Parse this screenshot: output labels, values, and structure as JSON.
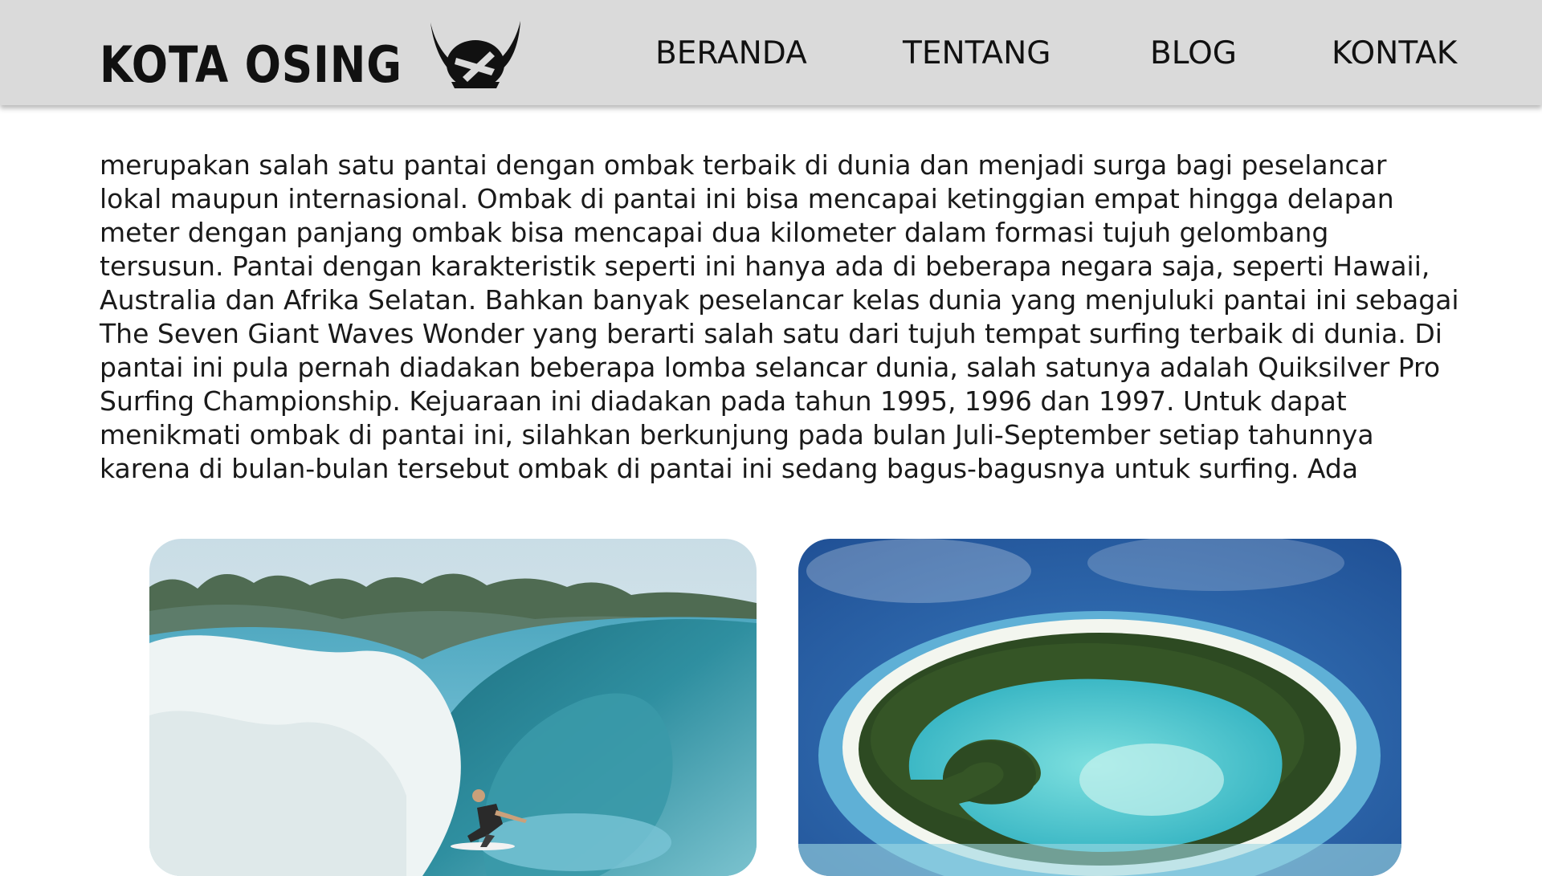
{
  "header": {
    "logo_text": "KOTA OSING",
    "logo_icon": "horned-helmet-icon",
    "nav": [
      {
        "label": "BERANDA"
      },
      {
        "label": "TENTANG"
      },
      {
        "label": "BLOG"
      },
      {
        "label": "KONTAK"
      }
    ]
  },
  "article": {
    "lines": [
      "merupakan salah satu pantai dengan ombak terbaik di dunia dan menjadi surga bagi peselancar",
      "lokal maupun internasional. Ombak di pantai ini bisa mencapai ketinggian empat hingga delapan",
      "meter dengan panjang ombak bisa mencapai dua kilometer dalam formasi tujuh gelombang",
      "tersusun. Pantai dengan karakteristik seperti ini hanya ada di beberapa negara saja, seperti Hawaii,",
      "Australia dan Afrika Selatan. Bahkan banyak peselancar kelas dunia yang menjuluki pantai ini sebagai",
      "The Seven Giant Waves Wonder yang berarti salah satu dari tujuh tempat surfing terbaik di dunia. Di",
      "pantai ini pula pernah diadakan beberapa lomba selancar dunia, salah satunya adalah Quiksilver Pro",
      "Surfing Championship. Kejuaraan ini diadakan pada tahun 1995, 1996 dan 1997. Untuk dapat",
      "menikmati ombak di pantai ini, silahkan berkunjung pada bulan Juli-September setiap tahunnya",
      "karena di bulan-bulan tersebut ombak di pantai ini sedang bagus-bagusnya untuk surfing. Ada"
    ]
  },
  "photos": [
    {
      "subject": "surfer-barrel-wave-photo"
    },
    {
      "subject": "aerial-atoll-island-photo"
    }
  ],
  "colors": {
    "header_bg": "#dadada",
    "text": "#1a1a1a",
    "ocean": "#2a6cb0",
    "lagoon": "#5fd6d2",
    "vegetation": "#2d4a22"
  }
}
